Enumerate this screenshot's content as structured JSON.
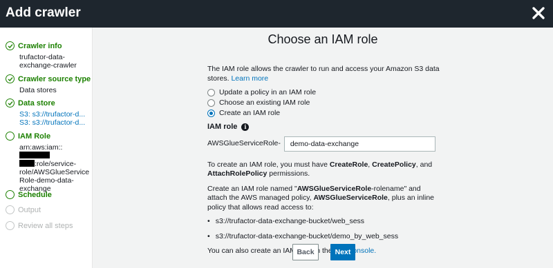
{
  "header": {
    "title": "Add crawler"
  },
  "sidebar": {
    "steps": [
      {
        "label": "Crawler info",
        "details": [
          "trufactor-data-",
          "exchange-crawler"
        ]
      },
      {
        "label": "Crawler source type",
        "details": [
          "Data stores"
        ]
      },
      {
        "label": "Data store",
        "details": [
          "S3: s3://trufactor-d...",
          "S3: s3://trufactor-d..."
        ]
      },
      {
        "label": "IAM Role",
        "details": [
          "arn:aws:iam::",
          ":role/service-",
          "role/AWSGlueService",
          "Role-demo-data-",
          "exchange"
        ]
      },
      {
        "label": "Schedule"
      },
      {
        "label": "Output"
      },
      {
        "label": "Review all steps"
      }
    ]
  },
  "main": {
    "title": "Choose an IAM role",
    "intro": "The IAM role allows the crawler to run and access your Amazon S3 data stores.",
    "learn_more": "Learn more",
    "options": [
      {
        "label": "Update a policy in an IAM role",
        "selected": false
      },
      {
        "label": "Choose an existing IAM role",
        "selected": false
      },
      {
        "label": "Create an IAM role",
        "selected": true
      }
    ],
    "iam_role_label": "IAM role",
    "role_prefix": "AWSGlueServiceRole-",
    "role_value": "demo-data-exchange",
    "perm_text_1": "To create an IAM role, you must have ",
    "perm_create_role": "CreateRole",
    "perm_comma": ", ",
    "perm_create_policy": "CreatePolicy",
    "perm_and": ", and",
    "perm_attach": "AttachRolePolicy",
    "perm_end": " permissions.",
    "create_text_1": "Create an IAM role named \"",
    "create_bold_1": "AWSGlueServiceRole",
    "create_text_2": "-rolename\" and attach the AWS managed policy, ",
    "create_bold_2": "AWSGlueServiceRole",
    "create_text_3": ", plus an inline policy that allows read access to:",
    "paths": [
      "s3://trufactor-data-exchange-bucket/web_sess",
      "s3://trufactor-data-exchange-bucket/demo_by_web_sess"
    ],
    "console_text": "You can also create an IAM role on the ",
    "console_link": "IAM console.",
    "back_label": "Back",
    "next_label": "Next"
  },
  "colors": {
    "success": "#1d8102",
    "link": "#0073bb",
    "header_bg": "#1e262e"
  },
  "icons": {
    "close": "close-icon",
    "check": "check-circle-icon",
    "info": "info-icon"
  }
}
